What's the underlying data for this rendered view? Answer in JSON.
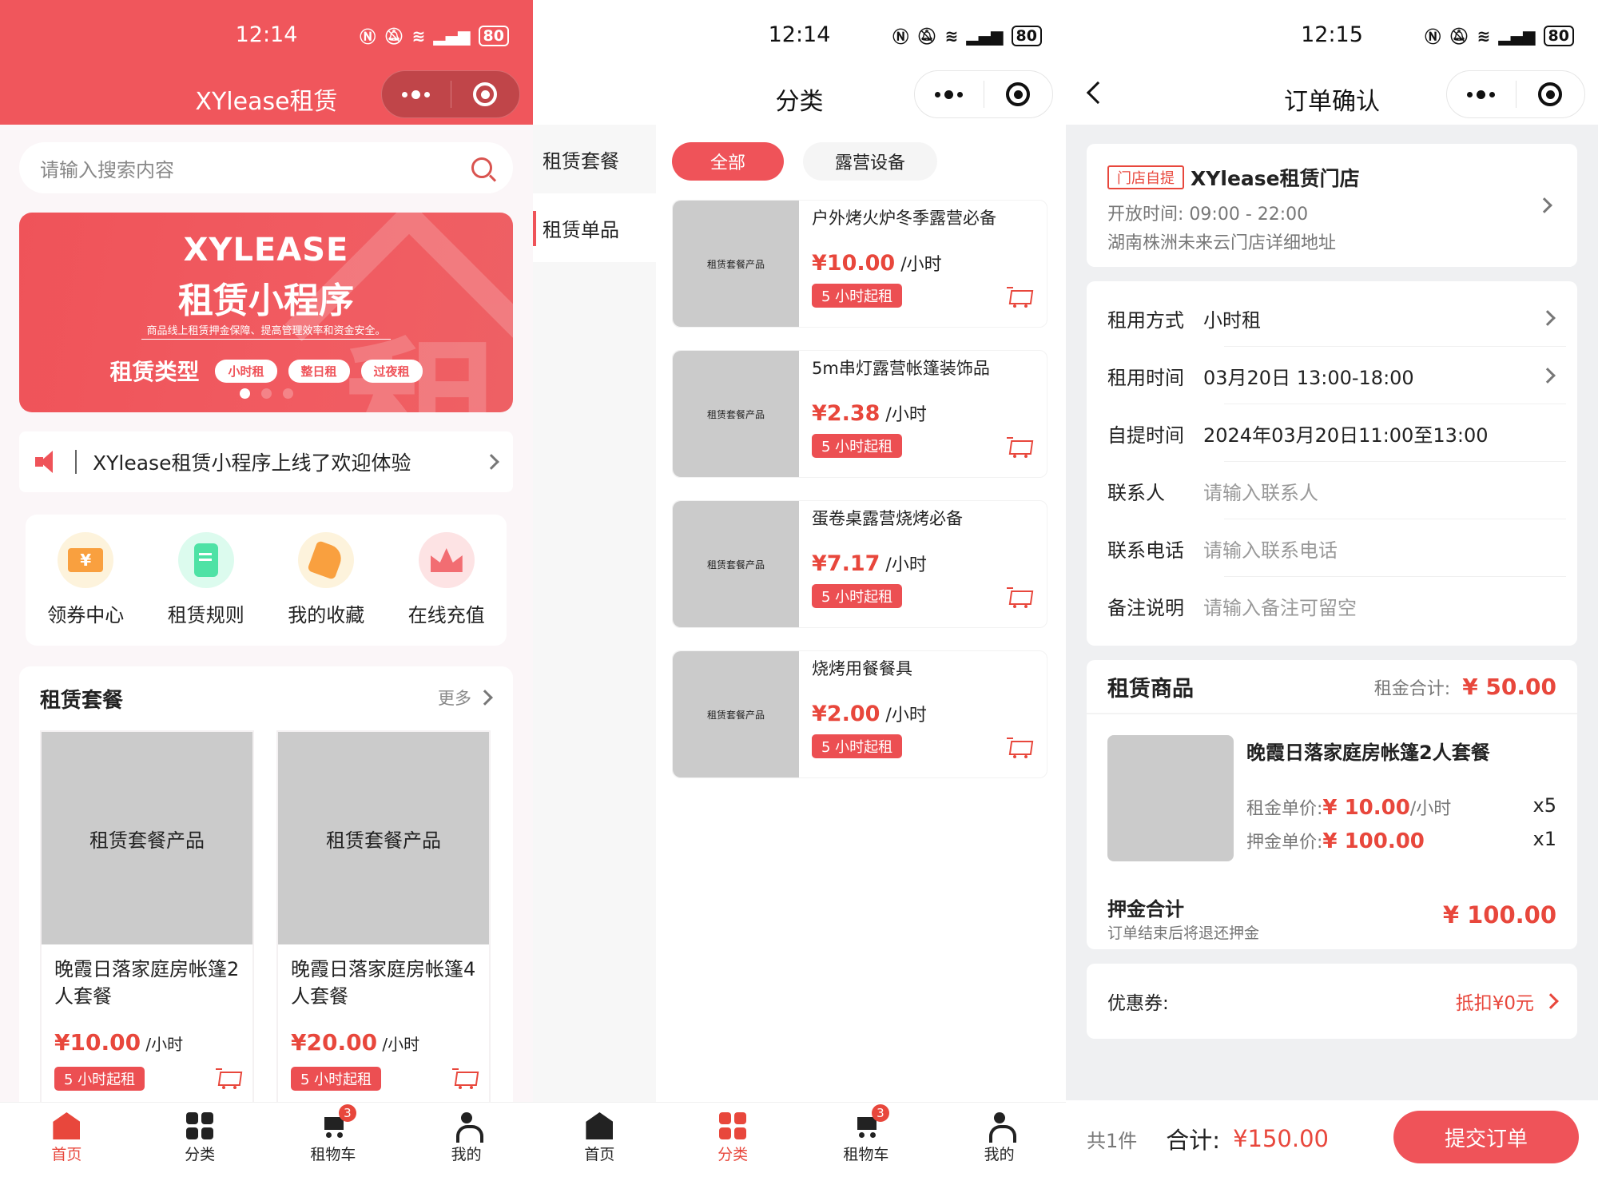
{
  "colors": {
    "brand": "#ef5359",
    "price": "#e8473c",
    "placeholder_img": "#cbcbcb"
  },
  "home": {
    "status": {
      "time": "12:14",
      "battery": "80",
      "signal": "4G"
    },
    "title": "XYlease租赁",
    "capsule": {
      "more_icon": "more-dots-icon",
      "close_icon": "target-icon"
    },
    "search": {
      "placeholder": "请输入搜索内容"
    },
    "banner": {
      "title_en": "XYLEASE",
      "title_cn": "租赁小程序",
      "subtitle": "商品线上租赁押金保障、提高管理效率和资金安全。",
      "types_label": "租赁类型",
      "types": [
        "小时租",
        "整日租",
        "过夜租"
      ],
      "decor_char": "租",
      "slides": 3,
      "active_slide": 1
    },
    "notice": {
      "text": "XYlease租赁小程序上线了欢迎体验"
    },
    "quick": [
      {
        "label": "领券中心",
        "icon": "coupon-icon",
        "bg": "#fdf3dc"
      },
      {
        "label": "租赁规则",
        "icon": "rules-doc-icon",
        "bg": "#dcfbee"
      },
      {
        "label": "我的收藏",
        "icon": "favorite-tag-icon",
        "bg": "#fdf3dc"
      },
      {
        "label": "在线充值",
        "icon": "recharge-crown-icon",
        "bg": "#fde3e4"
      }
    ],
    "packages": {
      "title": "租赁套餐",
      "more": "更多",
      "items": [
        {
          "image_text": "租赁套餐产品",
          "name": "晚霞日落家庭房帐篷2人套餐",
          "price": "¥10.00",
          "unit": "/小时",
          "tag": "5 小时起租"
        },
        {
          "image_text": "租赁套餐产品",
          "name": "晚霞日落家庭房帐篷4人套餐",
          "price": "¥20.00",
          "unit": "/小时",
          "tag": "5 小时起租"
        }
      ]
    }
  },
  "tabbar": [
    {
      "label": "首页",
      "icon": "home-icon"
    },
    {
      "label": "分类",
      "icon": "category-grid-icon"
    },
    {
      "label": "租物车",
      "icon": "cart-icon",
      "badge": "3"
    },
    {
      "label": "我的",
      "icon": "user-icon"
    }
  ],
  "category": {
    "status": {
      "time": "12:14",
      "battery": "80"
    },
    "title": "分类",
    "sidebar": [
      "租赁套餐",
      "租赁单品"
    ],
    "sidebar_active": 1,
    "chips": [
      "全部",
      "露营设备"
    ],
    "chip_active": 0,
    "products": [
      {
        "image_text": "租赁套餐产品",
        "name": "户外烤火炉冬季露营必备",
        "price": "¥10.00",
        "unit": "/小时",
        "tag": "5 小时起租"
      },
      {
        "image_text": "租赁套餐产品",
        "name": "5m串灯露营帐篷装饰品",
        "price": "¥2.38",
        "unit": "/小时",
        "tag": "5 小时起租"
      },
      {
        "image_text": "租赁套餐产品",
        "name": "蛋卷桌露营烧烤必备",
        "price": "¥7.17",
        "unit": "/小时",
        "tag": "5 小时起租"
      },
      {
        "image_text": "租赁套餐产品",
        "name": "烧烤用餐餐具",
        "price": "¥2.00",
        "unit": "/小时",
        "tag": "5 小时起租"
      }
    ]
  },
  "order": {
    "status": {
      "time": "12:15",
      "battery": "80"
    },
    "title": "订单确认",
    "store": {
      "tag": "门店自提",
      "name": "XYlease租赁门店",
      "hours_label": "开放时间:",
      "hours": "09:00 - 22:00",
      "address": "湖南株洲未来云门店详细地址"
    },
    "fields": [
      {
        "label": "租用方式",
        "value": "小时租",
        "arrow": true
      },
      {
        "label": "租用时间",
        "value": "03月20日 13:00-18:00",
        "arrow": true
      },
      {
        "label": "自提时间",
        "value": "2024年03月20日11:00至13:00"
      },
      {
        "label": "联系人",
        "placeholder": "请输入联系人"
      },
      {
        "label": "联系电话",
        "placeholder": "请输入联系电话"
      },
      {
        "label": "备注说明",
        "placeholder": "请输入备注可留空"
      }
    ],
    "goods": {
      "title": "租赁商品",
      "rent_total_label": "租金合计:",
      "rent_total": "¥ 50.00",
      "item": {
        "name": "晚霞日落家庭房帐篷2人套餐",
        "rent_label": "租金单价:",
        "rent_price": "¥ 10.00",
        "rent_unit": "/小时",
        "rent_qty": "x5",
        "deposit_label": "押金单价:",
        "deposit_price": "¥ 100.00",
        "deposit_qty": "x1"
      },
      "deposit_total_label": "押金合计",
      "deposit_note": "订单结束后将退还押金",
      "deposit_total": "¥ 100.00"
    },
    "coupon": {
      "label": "优惠券:",
      "value": "抵扣¥0元"
    },
    "footer": {
      "count": "共1件",
      "total_label": "合计:",
      "total": "¥150.00",
      "submit": "提交订单"
    }
  }
}
